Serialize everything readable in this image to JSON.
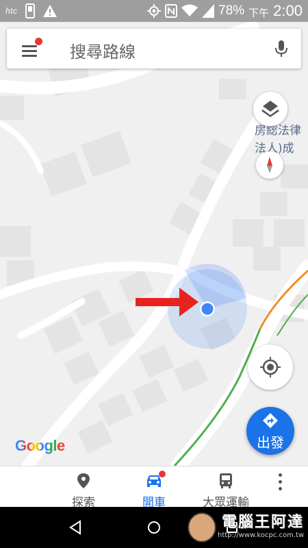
{
  "status_bar": {
    "carrier": "htc",
    "battery": "78%",
    "time_prefix": "下午",
    "time": "2:00"
  },
  "search": {
    "placeholder": "搜尋路線"
  },
  "map": {
    "poi_label_line1": "房総法律",
    "poi_label_line2": "法人)成",
    "google_logo": "Google",
    "location_color": "#4285f4"
  },
  "buttons": {
    "go_label": "出發"
  },
  "bottom_nav": {
    "tabs": [
      {
        "label": "探索",
        "icon": "explore-pin-icon",
        "active": false
      },
      {
        "label": "開車",
        "icon": "car-icon",
        "active": true
      },
      {
        "label": "大眾運輸",
        "icon": "bus-icon",
        "active": false
      }
    ]
  },
  "watermark": {
    "title": "電腦王阿達",
    "url": "http://www.kocpc.com.tw"
  },
  "colors": {
    "accent": "#1a73e8",
    "notification_dot": "#e53935",
    "annotation_arrow": "#e8231e",
    "traffic_green": "#4caf50",
    "traffic_orange": "#f28c28"
  }
}
